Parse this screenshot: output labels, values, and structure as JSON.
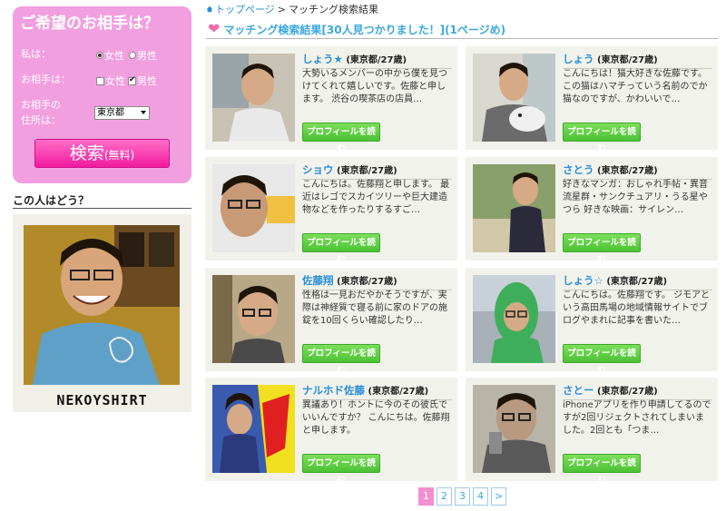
{
  "sidebar": {
    "search_title": "ご希望のお相手は？",
    "me_label": "私は：",
    "partner_label": "お相手は：",
    "address_label_1": "お相手の",
    "address_label_2": "住所は：",
    "female": "女性",
    "male": "男性",
    "me_selected": "female",
    "partner_checked": "male",
    "prefecture": "東京都",
    "search_button": "検索",
    "search_button_sub": "(無料)",
    "who_title": "この人はどう？",
    "photo_caption": "NEKOYSHIRT"
  },
  "breadcrumb": {
    "home": "トップページ",
    "separator": ">",
    "current": "マッチング検索結果"
  },
  "results_header": "マッチング検索結果[30人見つかりました！](1ページめ)",
  "cards": [
    {
      "name": "しょう★",
      "meta": "(東京都/27歳)",
      "desc": "大勢いるメンバーの中から僕を見つけてくれて嬉しいです。佐藤と申します。 渋谷の喫茶店の店員…",
      "button": "プロフィールを読む"
    },
    {
      "name": "しょう",
      "meta": "(東京都/27歳)",
      "desc": "こんにちは！猫大好きな佐藤です。 この猫はハマチっていう名前のでか猫なのですが、かわいいで…",
      "button": "プロフィールを読む"
    },
    {
      "name": "ショウ",
      "meta": "(東京都/27歳)",
      "desc": "こんにちは。佐藤翔と申します。 最近はレゴでスカイツリーや巨大建造物などを作ったりするすご…",
      "button": "プロフィールを読む"
    },
    {
      "name": "さとう",
      "meta": "(東京都/27歳)",
      "desc": "好きなマンガ：おしゃれ手帖・異音流星群・サンクチュアリ・うる星やつら 好きな映画：サイレン…",
      "button": "プロフィールを読む"
    },
    {
      "name": "佐藤翔",
      "meta": "(東京都/27歳)",
      "desc": "性格は一見おだやかそうですが、実際は神経質で寝る前に家のドアの施錠を10回くらい確認したり…",
      "button": "プロフィールを読む"
    },
    {
      "name": "しょう☆",
      "meta": "(東京都/27歳)",
      "desc": "こんにちは。佐藤翔です。 ジモアという高田馬場の地域情報サイトでブログやまれに記事を書いた…",
      "button": "プロフィールを読む"
    },
    {
      "name": "ナルホド佐藤",
      "meta": "(東京都/27歳)",
      "desc": "異議あり！ホントに今のその彼氏でいいんですか？ こんにちは。佐藤翔と申します。",
      "button": "プロフィールを読む"
    },
    {
      "name": "さとー",
      "meta": "(東京都/27歳)",
      "desc": "iPhoneアプリを作り申請してるのですが2回リジェクトされてしまいました。2回とも「つま…",
      "button": "プロフィールを読む"
    }
  ],
  "pagination": [
    "1",
    "2",
    "3",
    "4",
    ">"
  ],
  "current_page": "1",
  "colors": {
    "sidebar_pink": "#f29fe0",
    "search_button": "#f21aa0",
    "accent_blue": "#3aa8e0",
    "profile_green": "#4cc235",
    "card_bg": "#f2f2ec"
  }
}
